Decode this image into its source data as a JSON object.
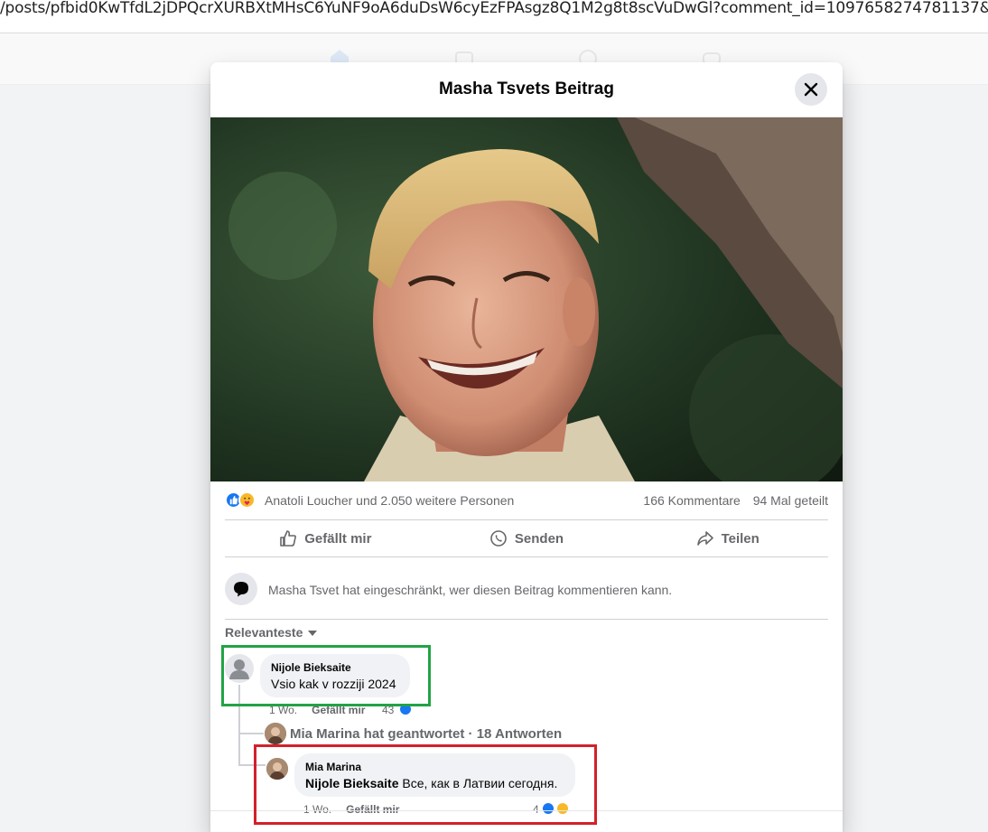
{
  "browser": {
    "url": "/posts/pfbid0KwTfdL2jDPQcrXURBXtMHsC6YuNF9oA6duDsW6cyEzFPAsgz8Q1M2g8t8scVuDwGl?comment_id=1097658274781137&reply_com"
  },
  "modal": {
    "title": "Masha Tsvets Beitrag"
  },
  "stats": {
    "reactors": "Anatoli Loucher und 2.050 weitere Personen",
    "comments": "166 Kommentare",
    "shares": "94 Mal geteilt"
  },
  "actions": {
    "like": "Gefällt mir",
    "send": "Senden",
    "share": "Teilen"
  },
  "restriction_notice": "Masha Tsvet hat eingeschränkt, wer diesen Beitrag kommentieren kann.",
  "sort_label": "Relevanteste",
  "comment": {
    "author": "Nijole Bieksaite",
    "text": "Vsio kak v rozziji 2024",
    "age": "1 Wo.",
    "like_label": "Gefällt mir",
    "reaction_count": "43"
  },
  "reply_summary": "Mia Marina hat geantwortet · 18 Antworten",
  "reply": {
    "author": "Mia Marina",
    "mention": "Nijole Bieksaite",
    "text": "Все, как в Латвии сегодня.",
    "age": "1 Wo.",
    "like_label": "Gefällt mir",
    "reaction_count": "4"
  },
  "colors": {
    "highlight_green": "#22a345",
    "highlight_red": "#d4202a",
    "like_blue": "#1877f2"
  }
}
